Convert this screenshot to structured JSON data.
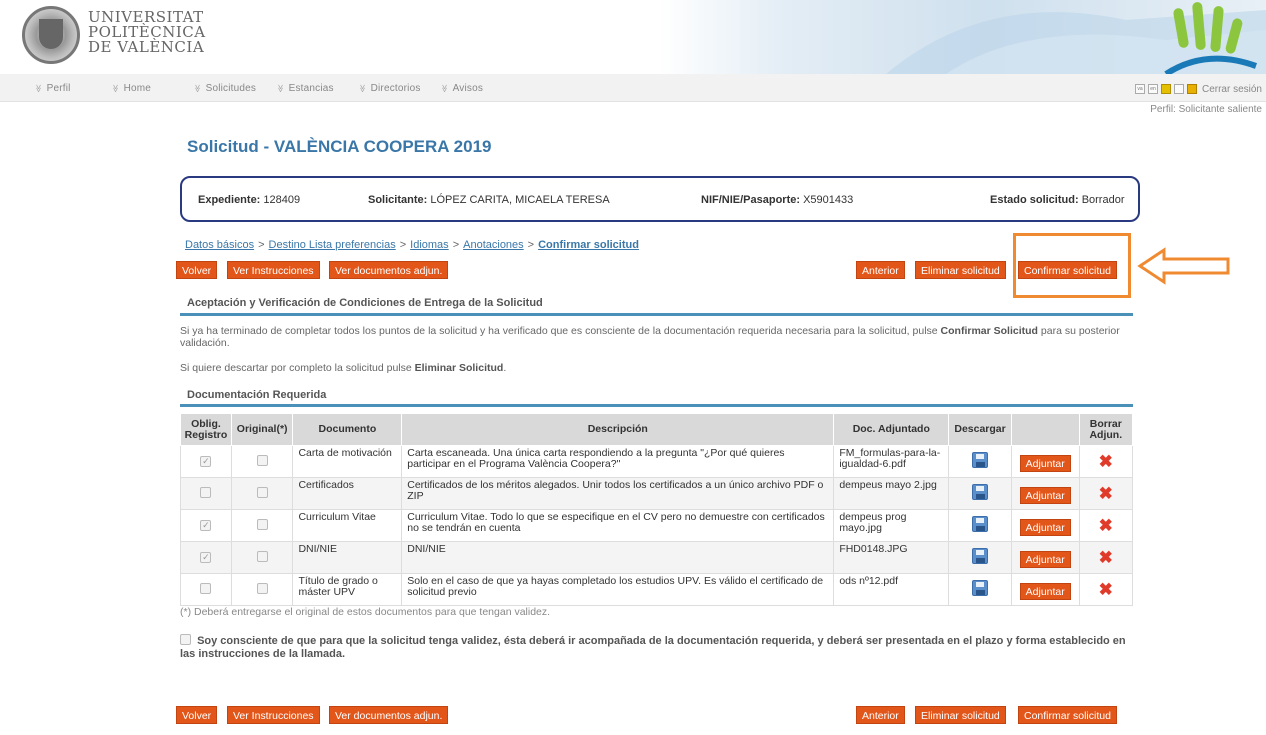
{
  "header": {
    "university_lines": [
      "UNIVERSITAT",
      "POLITÈCNICA",
      "DE VALÈNCIA"
    ]
  },
  "nav": {
    "items": [
      "Perfil",
      "Home",
      "Solicitudes",
      "Estancias",
      "Directorios",
      "Avisos"
    ],
    "lang_icons": [
      "va",
      "en"
    ],
    "logout": "Cerrar sesión",
    "profile": "Perfil: Solicitante saliente"
  },
  "page": {
    "title": "Solicitud - VALÈNCIA COOPERA 2019"
  },
  "info": {
    "expediente_label": "Expediente:",
    "expediente_value": "128409",
    "solicitante_label": "Solicitante:",
    "solicitante_value": "LÓPEZ CARITA, MICAELA TERESA",
    "nif_label": "NIF/NIE/Pasaporte:",
    "nif_value": "X5901433",
    "estado_label": "Estado solicitud:",
    "estado_value": "Borrador"
  },
  "breadcrumb": {
    "items": [
      "Datos básicos",
      "Destino Lista preferencias",
      "Idiomas",
      "Anotaciones",
      "Confirmar solicitud"
    ],
    "separator": ">"
  },
  "buttons": {
    "volver": "Volver",
    "ver_instrucciones": "Ver Instrucciones",
    "ver_documentos": "Ver documentos adjun.",
    "anterior": "Anterior",
    "eliminar": "Eliminar solicitud",
    "confirmar": "Confirmar solicitud"
  },
  "section1": {
    "title": "Aceptación y Verificación de Condiciones de Entrega de la Solicitud",
    "para1_a": "Si ya ha terminado de completar todos los puntos de la solicitud y ha verificado que es consciente de la documentación requerida necesaria para la solicitud, pulse",
    "para1_bold": "Confirmar Solicitud",
    "para1_b": "para su posterior validación.",
    "para2_a": "Si quiere descartar por completo la solicitud pulse",
    "para2_bold": "Eliminar Solicitud",
    "para2_b": "."
  },
  "section2": {
    "title": "Documentación Requerida"
  },
  "table": {
    "headers": [
      "Oblig. Registro",
      "Original(*)",
      "Documento",
      "Descripción",
      "Doc. Adjuntado",
      "Descargar",
      "",
      "Borrar Adjun."
    ],
    "adjuntar_label": "Adjuntar",
    "rows": [
      {
        "oblig": true,
        "original": false,
        "documento": "Carta de motivación",
        "descripcion": "Carta escaneada. Una única carta respondiendo a la pregunta \"¿Por qué quieres participar en el Programa València Coopera?\"",
        "adjunto": "FM_formulas-para-la-igualdad-6.pdf"
      },
      {
        "oblig": false,
        "original": false,
        "documento": "Certificados",
        "descripcion": "Certificados de los méritos alegados. Unir todos los certificados a un único archivo PDF o ZIP",
        "adjunto": "dempeus mayo 2.jpg"
      },
      {
        "oblig": true,
        "original": false,
        "documento": "Curriculum Vitae",
        "descripcion": "Curriculum Vitae. Todo lo que se especifique en el CV pero no demuestre con certificados no se tendrán en cuenta",
        "adjunto": "dempeus prog mayo.jpg"
      },
      {
        "oblig": true,
        "original": false,
        "documento": "DNI/NIE",
        "descripcion": "DNI/NIE",
        "adjunto": "FHD0148.JPG"
      },
      {
        "oblig": false,
        "original": false,
        "documento": "Título de grado o máster UPV",
        "descripcion": "Solo en el caso de que ya hayas completado los estudios UPV. Es válido el certificado de solicitud previo",
        "adjunto": "ods nº12.pdf"
      }
    ]
  },
  "footnote": "(*) Deberá entregarse el original de estos documentos para que tengan validez.",
  "ack": "Soy consciente de que para que la solicitud tenga validez, ésta deberá ir acompañada de la documentación requerida, y deberá ser presentada en el plazo y forma establecido en las instrucciones de la llamada."
}
